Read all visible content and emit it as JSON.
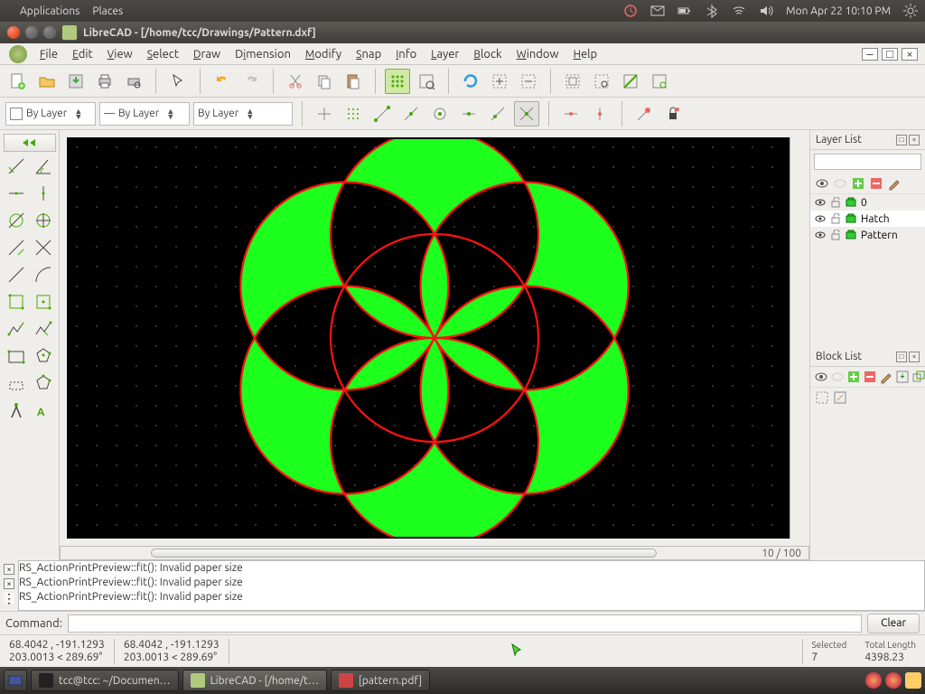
{
  "panel": {
    "apps": "Applications",
    "places": "Places",
    "clock": "Mon Apr 22  10:10 PM"
  },
  "titlebar": "LibreCAD - [/home/tcc/Drawings/Pattern.dxf]",
  "menus": [
    "File",
    "Edit",
    "View",
    "Select",
    "Draw",
    "Dimension",
    "Modify",
    "Snap",
    "Info",
    "Layer",
    "Block",
    "Window",
    "Help"
  ],
  "combo": {
    "color": "By Layer",
    "width": "By Layer",
    "ltype": "By Layer"
  },
  "page": "10 / 100",
  "log": [
    "RS_ActionPrintPreview::fit(): Invalid paper size",
    "RS_ActionPrintPreview::fit(): Invalid paper size",
    "RS_ActionPrintPreview::fit(): Invalid paper size"
  ],
  "cmd": {
    "label": "Command:",
    "clear": "Clear"
  },
  "status": {
    "c1a": "68.4042 , -191.1293",
    "c1b": "203.0013 < 289.69°",
    "c2a": "68.4042 , -191.1293",
    "c2b": "203.0013 < 289.69°",
    "selLbl": "Selected",
    "selVal": "7",
    "lenLbl": "Total Length",
    "lenVal": "4398.23"
  },
  "layerPanel": {
    "title": "Layer List",
    "layers": [
      "0",
      "Hatch",
      "Pattern"
    ]
  },
  "blockPanel": {
    "title": "Block List"
  },
  "task": {
    "t1": "tcc@tcc: ~/Documen…",
    "t2": "LibreCAD - [/home/t…",
    "t3": "[pattern.pdf]"
  }
}
